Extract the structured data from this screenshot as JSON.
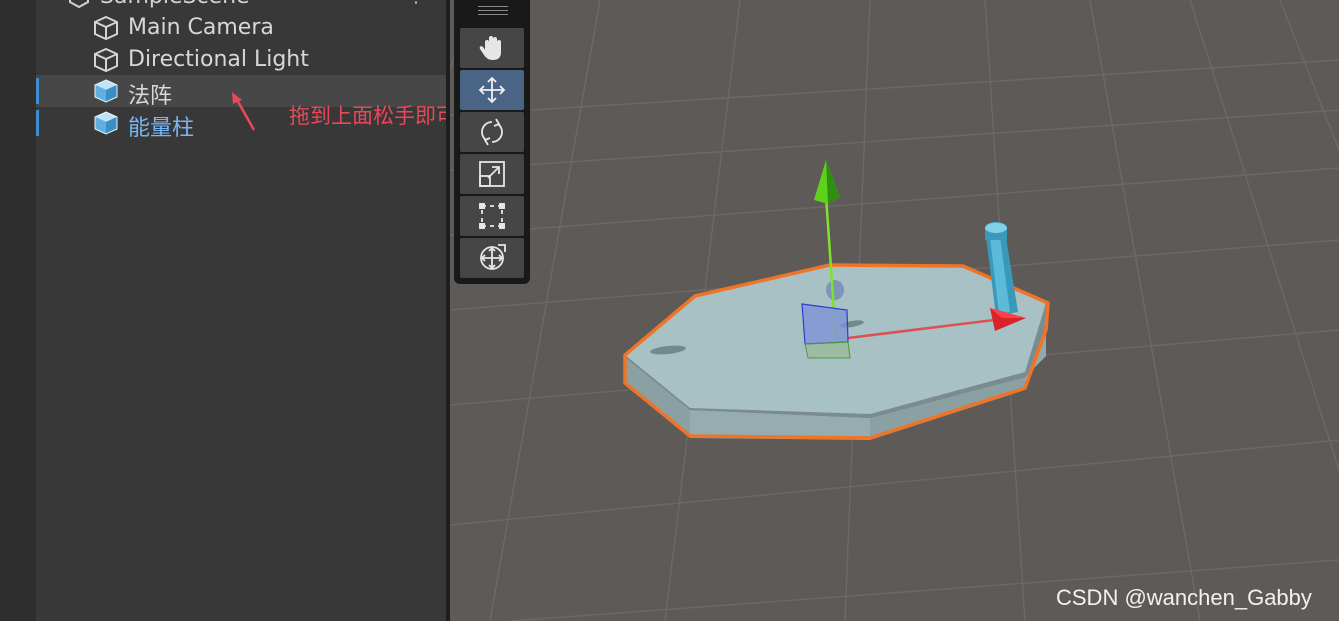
{
  "hierarchy": {
    "scene_name": "SampleScene",
    "items": [
      {
        "label": "Main Camera",
        "type": "gameobject"
      },
      {
        "label": "Directional Light",
        "type": "gameobject"
      },
      {
        "label": "法阵",
        "type": "prefab"
      },
      {
        "label": "能量柱",
        "type": "prefab"
      }
    ]
  },
  "annotation": {
    "text": "拖到上面松手即可",
    "color": "#e8485a"
  },
  "tools": [
    {
      "name": "hand-tool",
      "icon": "hand-icon",
      "active": false
    },
    {
      "name": "move-tool",
      "icon": "move-arrows-icon",
      "active": true
    },
    {
      "name": "rotate-tool",
      "icon": "rotate-icon",
      "active": false
    },
    {
      "name": "scale-tool",
      "icon": "scale-icon",
      "active": false
    },
    {
      "name": "rect-tool",
      "icon": "rect-transform-icon",
      "active": false
    },
    {
      "name": "transform-tool",
      "icon": "transform-icon",
      "active": false
    }
  ],
  "colors": {
    "selection_outline": "#f07427",
    "prefab_text": "#7ab6f5",
    "gizmo_y": "#7fe22c",
    "gizmo_x": "#d9232b",
    "active_tool": "#4a6486"
  },
  "watermark": "CSDN @wanchen_Gabby"
}
